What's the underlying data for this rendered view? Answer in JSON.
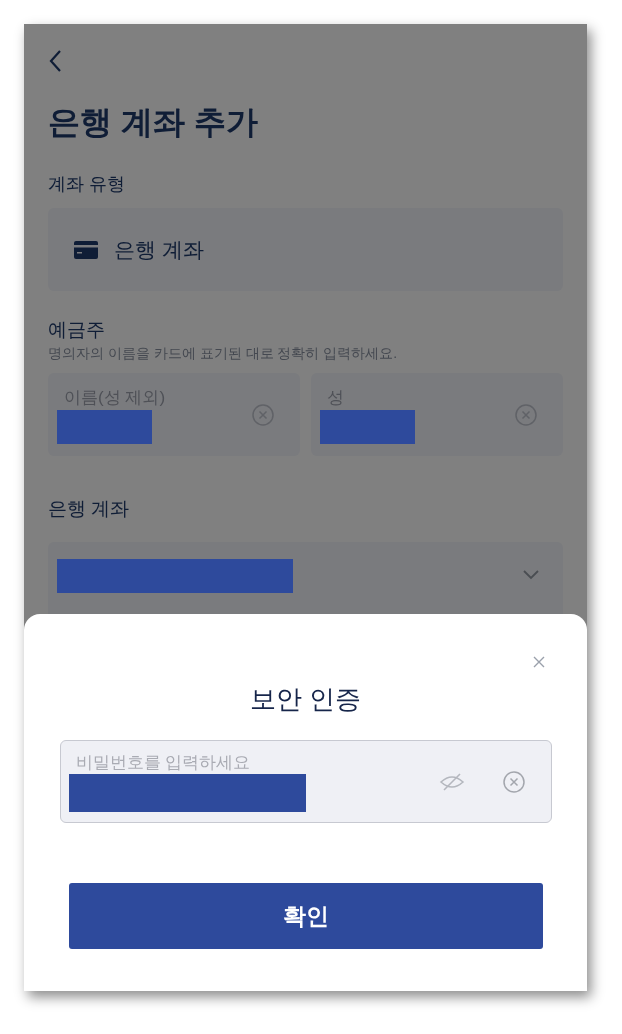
{
  "header": {
    "title": "은행 계좌 추가"
  },
  "account_type": {
    "label": "계좌 유형",
    "value": "은행 계좌"
  },
  "holder": {
    "label": "예금주",
    "hint": "명의자의 이름을 카드에 표기된 대로 정확히 입력하세요.",
    "fields": [
      {
        "placeholder": "이름(성 제외)",
        "redacted": true
      },
      {
        "placeholder": "성",
        "redacted": true
      }
    ]
  },
  "bank_account": {
    "label": "은행 계좌",
    "redacted": true
  },
  "dialog": {
    "title": "보안 인증",
    "password": {
      "placeholder": "비밀번호를 입력하세요",
      "redacted": true
    },
    "button": "확인"
  }
}
